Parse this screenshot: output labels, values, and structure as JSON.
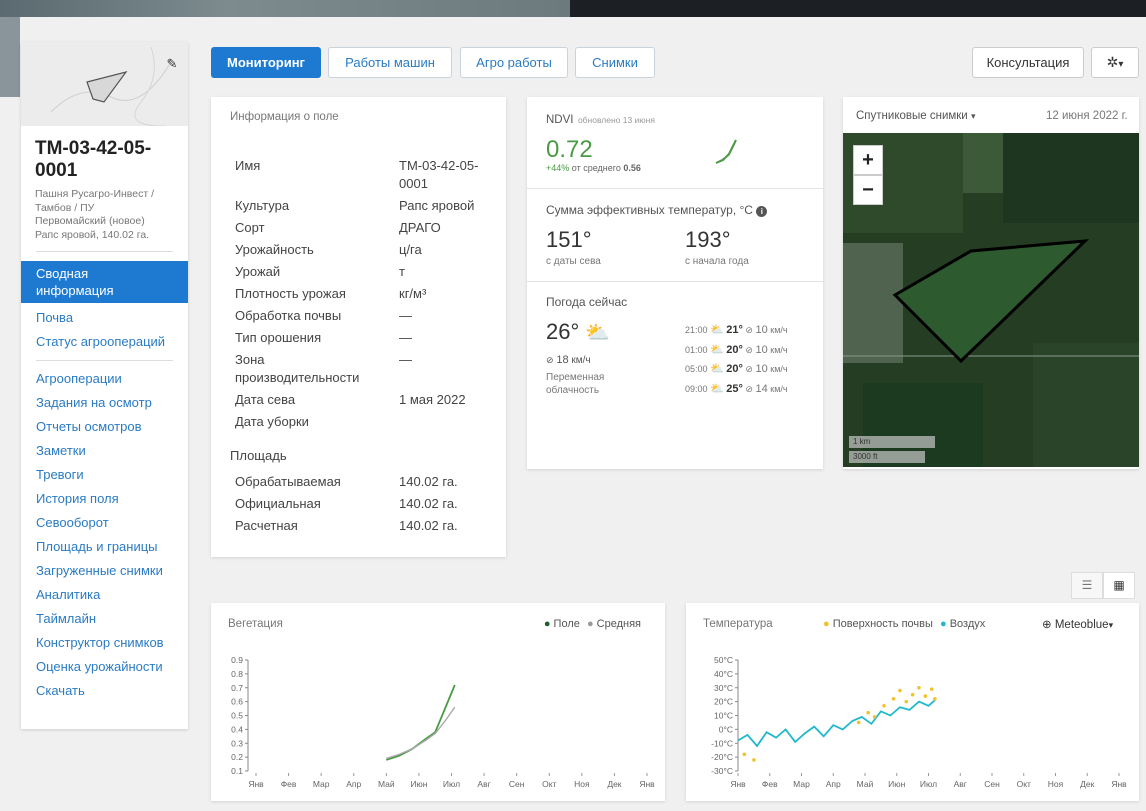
{
  "field": {
    "name": "ТМ-03-42-05-0001",
    "subtitle_lines": [
      "Пашня Русагро-Инвест /",
      "Тамбов / ПУ",
      "Первомайский (новое)",
      "Рапс яровой, 140.02 га."
    ]
  },
  "sidebar": {
    "active_lines": [
      "Сводная",
      "информация"
    ],
    "group1": [
      "Почва",
      "Статус агроопераций"
    ],
    "group2": [
      "Агрооперации",
      "Задания на осмотр",
      "Отчеты осмотров",
      "Заметки",
      "Тревоги",
      "История поля",
      "Севооборот",
      "Площадь и границы",
      "Загруженные снимки",
      "Аналитика",
      "Таймлайн",
      "Конструктор снимков",
      "Оценка урожайности",
      "Скачать"
    ]
  },
  "tabs": {
    "monitoring": "Мониторинг",
    "machines": "Работы машин",
    "agro": "Агро работы",
    "images": "Снимки"
  },
  "toolbar": {
    "consult": "Консультация",
    "gear_icon": "gear-icon",
    "gear_caret": "▾"
  },
  "info": {
    "title": "Информация о поле",
    "rows": [
      {
        "label": "Имя",
        "value_lines": [
          "ТМ-03-42-05-",
          "0001"
        ]
      },
      {
        "label": "Культура",
        "value": "Рапс яровой"
      },
      {
        "label": "Сорт",
        "value": "ДРАГО"
      },
      {
        "label": "Урожайность",
        "value": "ц/га"
      },
      {
        "label": "Урожай",
        "value": "т"
      },
      {
        "label": "Плотность урожая",
        "value": "кг/м³"
      },
      {
        "label": "Обработка почвы",
        "value": "—"
      },
      {
        "label": "Тип орошения",
        "value": "—"
      },
      {
        "label_lines": [
          "Зона",
          "производительности"
        ],
        "value": "—"
      },
      {
        "label": "Дата сева",
        "value": "1 мая 2022"
      },
      {
        "label": "Дата уборки",
        "value": ""
      }
    ],
    "area_title": "Площадь",
    "area_rows": [
      {
        "label": "Обрабатываемая",
        "value": "140.02 га."
      },
      {
        "label": "Официальная",
        "value": "140.02 га."
      },
      {
        "label": "Расчетная",
        "value": "140.02 га."
      }
    ]
  },
  "ndvi": {
    "label": "NDVI",
    "updated": "обновлено 13 июня",
    "value": "0.72",
    "delta": "+44%",
    "delta_text": "от среднего",
    "avg": "0.56"
  },
  "gdd": {
    "title": "Сумма эффективных температур, °C",
    "info_icon": "info-icon",
    "since_sowing": "151°",
    "since_sowing_label": "с даты сева",
    "since_year": "193°",
    "since_year_label": "с начала года"
  },
  "weather": {
    "title": "Погода сейчас",
    "temp": "26°",
    "wind": "18",
    "wind_unit": "км/ч",
    "desc_lines": [
      "Переменная",
      "облачность"
    ],
    "forecast": [
      {
        "time": "21:00",
        "temp": "21°",
        "wind": "10",
        "unit": "км/ч"
      },
      {
        "time": "01:00",
        "temp": "20°",
        "wind": "10",
        "unit": "км/ч"
      },
      {
        "time": "05:00",
        "temp": "20°",
        "wind": "10",
        "unit": "км/ч"
      },
      {
        "time": "09:00",
        "temp": "25°",
        "wind": "14",
        "unit": "км/ч"
      }
    ]
  },
  "satellite": {
    "label": "Спутниковые снимки",
    "date": "12 июня 2022 г.",
    "zoom_in": "+",
    "zoom_out": "−",
    "scale_km": "1 km",
    "scale_ft": "3000 ft"
  },
  "view_toggle": {
    "list_icon": "list-icon",
    "grid_icon": "grid-icon"
  },
  "vegetation": {
    "title": "Вегетация",
    "legend_field": "Поле",
    "legend_avg": "Средняя"
  },
  "temperature": {
    "title": "Температура",
    "legend_soil": "Поверхность почвы",
    "legend_air": "Воздух",
    "source": "Meteoblue"
  },
  "colors": {
    "accent": "#1e7ad0",
    "field_series": "#4a9a44",
    "avg_series": "#aaaaaa",
    "soil_series": "#f2c22b",
    "air_series": "#21b8cc"
  },
  "chart_data": [
    {
      "type": "line",
      "title": "Вегетация",
      "x": [
        "Янв",
        "Фев",
        "Мар",
        "Апр",
        "Май",
        "Июн",
        "Июл",
        "Авг",
        "Сен",
        "Окт",
        "Ноя",
        "Дек",
        "Янв"
      ],
      "yticks": [
        "0.9",
        "0.8",
        "0.7",
        "0.6",
        "0.5",
        "0.4",
        "0.3",
        "0.2",
        "0.1"
      ],
      "ylim": [
        0.1,
        0.9
      ],
      "series": [
        {
          "name": "Поле",
          "points": [
            [
              4.0,
              0.18
            ],
            [
              4.4,
              0.21
            ],
            [
              4.8,
              0.26
            ],
            [
              5.2,
              0.33
            ],
            [
              5.5,
              0.38
            ],
            [
              5.8,
              0.55
            ],
            [
              6.1,
              0.72
            ]
          ]
        },
        {
          "name": "Средняя",
          "points": [
            [
              4.0,
              0.19
            ],
            [
              4.4,
              0.22
            ],
            [
              4.8,
              0.26
            ],
            [
              5.2,
              0.32
            ],
            [
              5.5,
              0.37
            ],
            [
              5.8,
              0.46
            ],
            [
              6.1,
              0.56
            ]
          ]
        }
      ],
      "legend": "top-right"
    },
    {
      "type": "line",
      "title": "Температура",
      "x": [
        "Янв",
        "Фев",
        "Мар",
        "Апр",
        "Май",
        "Июн",
        "Июл",
        "Авг",
        "Сен",
        "Окт",
        "Ноя",
        "Дек",
        "Янв"
      ],
      "yticks": [
        "50°C",
        "40°C",
        "30°C",
        "20°C",
        "10°C",
        "0°C",
        "-10°C",
        "-20°C",
        "-30°C"
      ],
      "ylim": [
        -30,
        50
      ],
      "series": [
        {
          "name": "Воздух",
          "points": [
            [
              0.0,
              -8
            ],
            [
              0.3,
              -4
            ],
            [
              0.6,
              -12
            ],
            [
              0.9,
              -2
            ],
            [
              1.2,
              -6
            ],
            [
              1.5,
              0
            ],
            [
              1.8,
              -9
            ],
            [
              2.1,
              -3
            ],
            [
              2.4,
              2
            ],
            [
              2.7,
              -5
            ],
            [
              3.0,
              3
            ],
            [
              3.3,
              0
            ],
            [
              3.6,
              6
            ],
            [
              3.9,
              9
            ],
            [
              4.2,
              4
            ],
            [
              4.5,
              13
            ],
            [
              4.8,
              10
            ],
            [
              5.1,
              16
            ],
            [
              5.4,
              14
            ],
            [
              5.7,
              20
            ],
            [
              6.0,
              17
            ],
            [
              6.2,
              21
            ]
          ]
        },
        {
          "name": "Поверхность почвы",
          "points": [
            [
              0.2,
              -18
            ],
            [
              0.5,
              -22
            ],
            [
              3.8,
              5
            ],
            [
              4.1,
              12
            ],
            [
              4.3,
              9
            ],
            [
              4.6,
              17
            ],
            [
              4.9,
              22
            ],
            [
              5.1,
              28
            ],
            [
              5.3,
              20
            ],
            [
              5.5,
              25
            ],
            [
              5.7,
              30
            ],
            [
              5.9,
              24
            ],
            [
              6.1,
              29
            ],
            [
              6.2,
              22
            ]
          ]
        }
      ],
      "legend": "top-right"
    }
  ]
}
